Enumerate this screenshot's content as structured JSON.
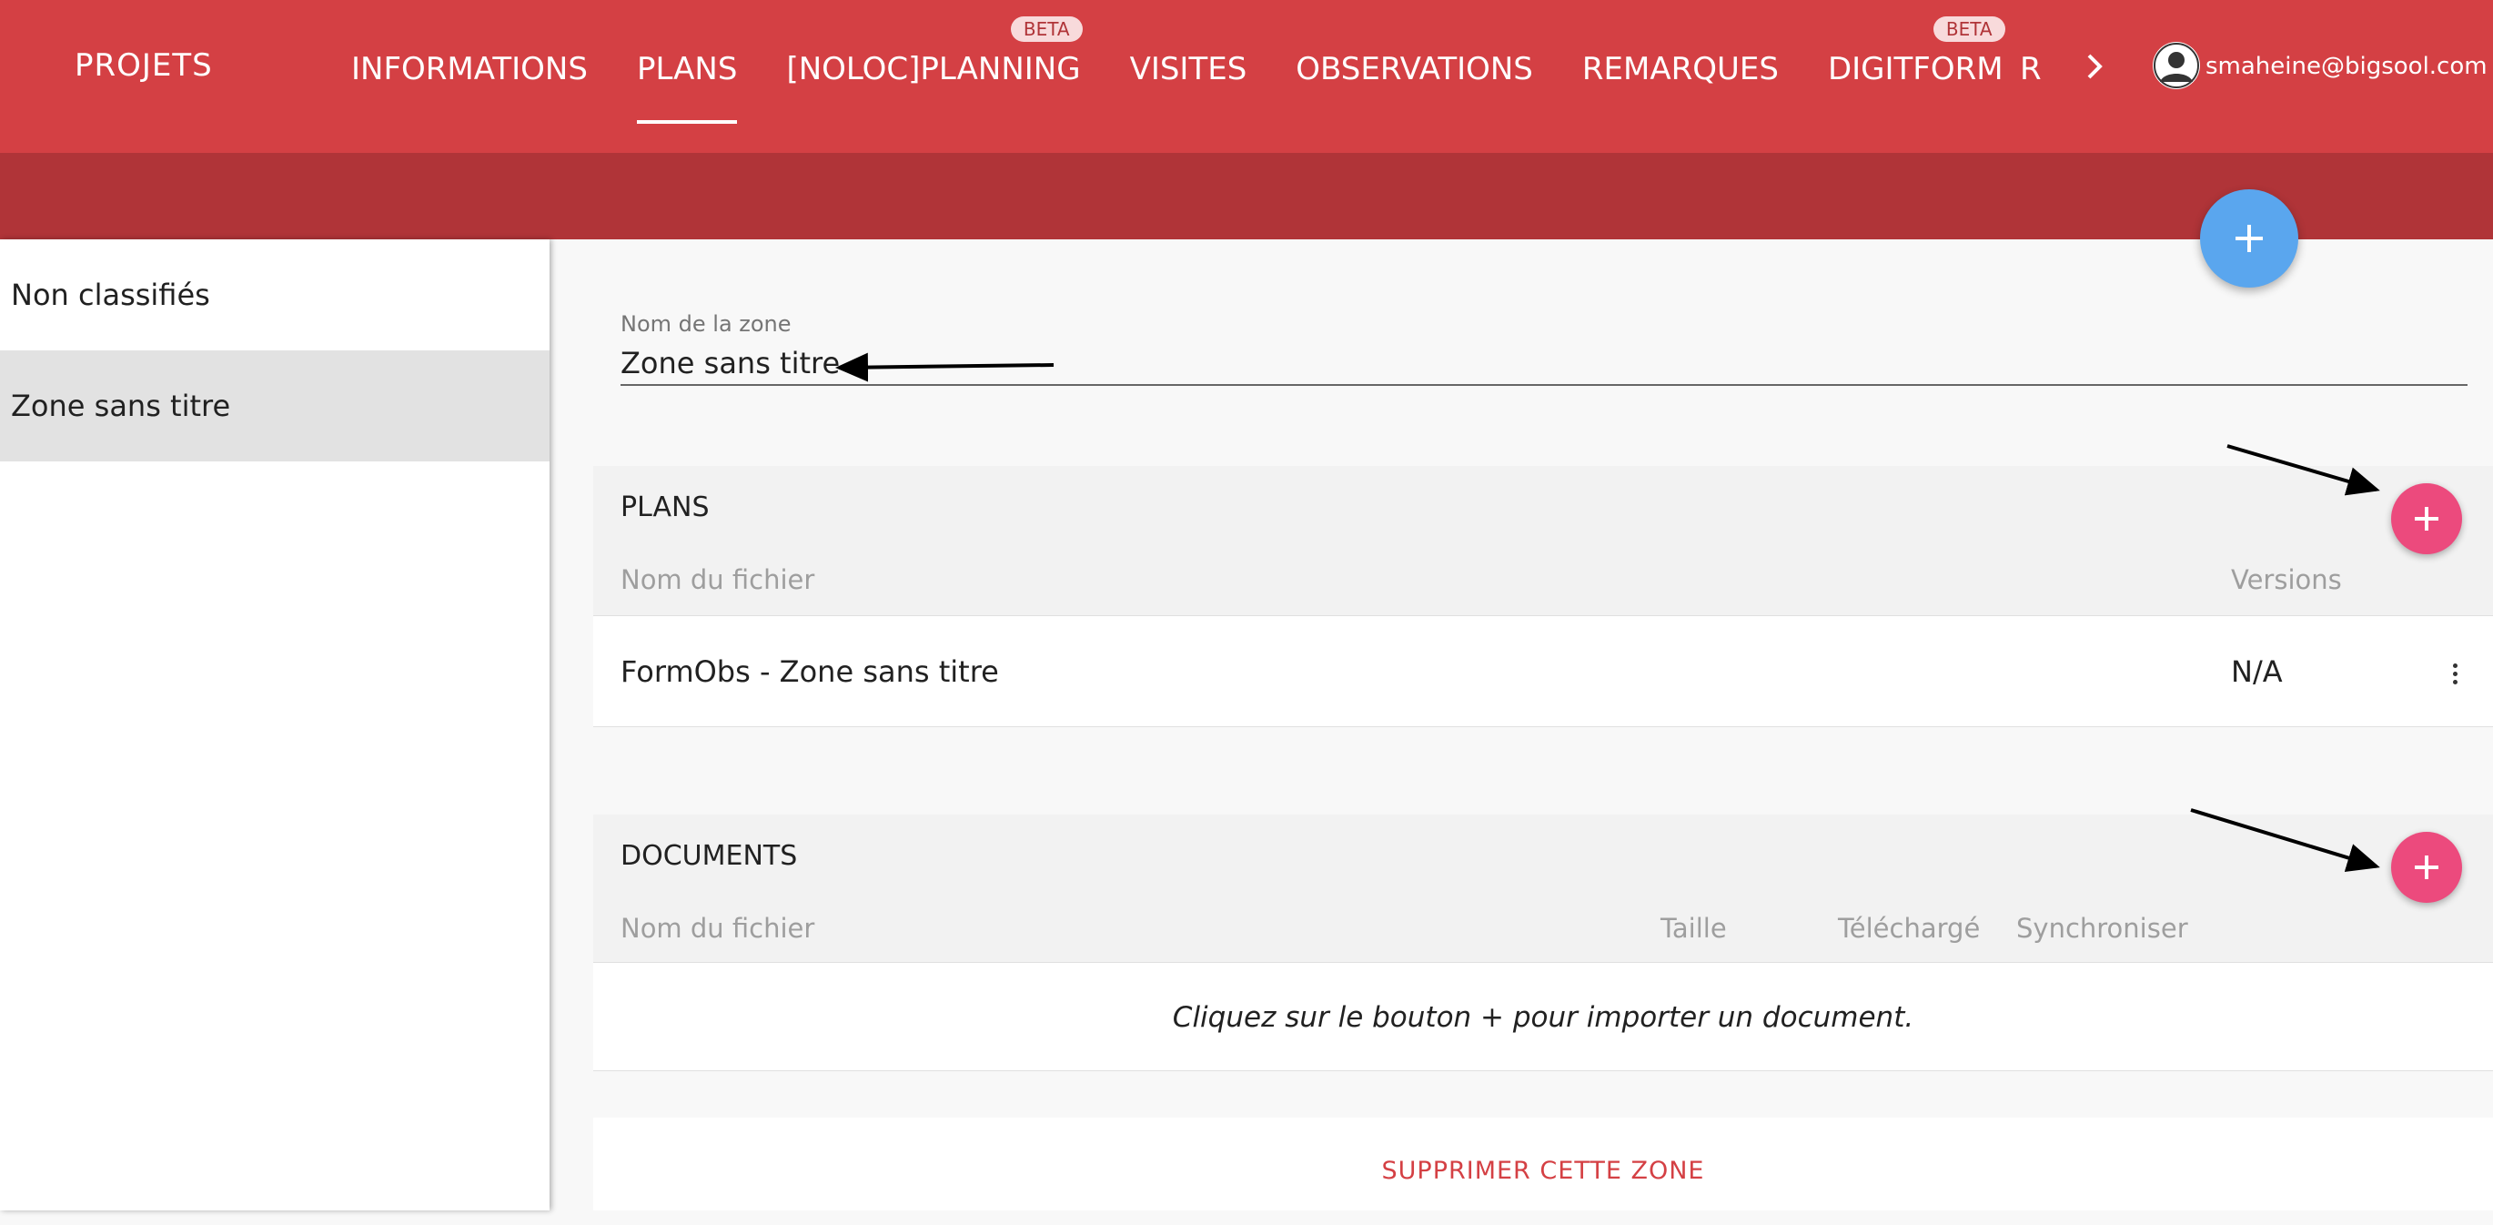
{
  "header": {
    "brand": "PROJETS",
    "tabs": [
      {
        "label": "INFORMATIONS"
      },
      {
        "label": "PLANS"
      },
      {
        "label": "[NOLOC]PLANNING",
        "badge": "BETA"
      },
      {
        "label": "VISITES"
      },
      {
        "label": "OBSERVATIONS"
      },
      {
        "label": "REMARQUES"
      },
      {
        "label": "DIGITFORM",
        "badge": "BETA"
      }
    ],
    "overflow_tab": "R",
    "user_email": "smaheine@bigsool.com",
    "colors": {
      "primary": "#d44044",
      "subbar": "#b03438",
      "fab": "#5aa6ee",
      "accent": "#ec4a7d"
    }
  },
  "sidebar": {
    "items": [
      {
        "label": "Non classifiés"
      },
      {
        "label": "Zone sans titre"
      }
    ]
  },
  "zone": {
    "field_label": "Nom de la zone",
    "field_value": "Zone sans titre"
  },
  "plans": {
    "title": "PLANS",
    "col_file": "Nom du fichier",
    "col_versions": "Versions",
    "rows": [
      {
        "name": "FormObs - Zone sans titre",
        "versions": "N/A"
      }
    ]
  },
  "documents": {
    "title": "DOCUMENTS",
    "col_file": "Nom du fichier",
    "col_size": "Taille",
    "col_downloaded": "Téléchargé",
    "col_sync": "Synchroniser",
    "empty_message": "Cliquez sur le bouton + pour importer un document."
  },
  "delete_label": "SUPPRIMER CETTE ZONE"
}
